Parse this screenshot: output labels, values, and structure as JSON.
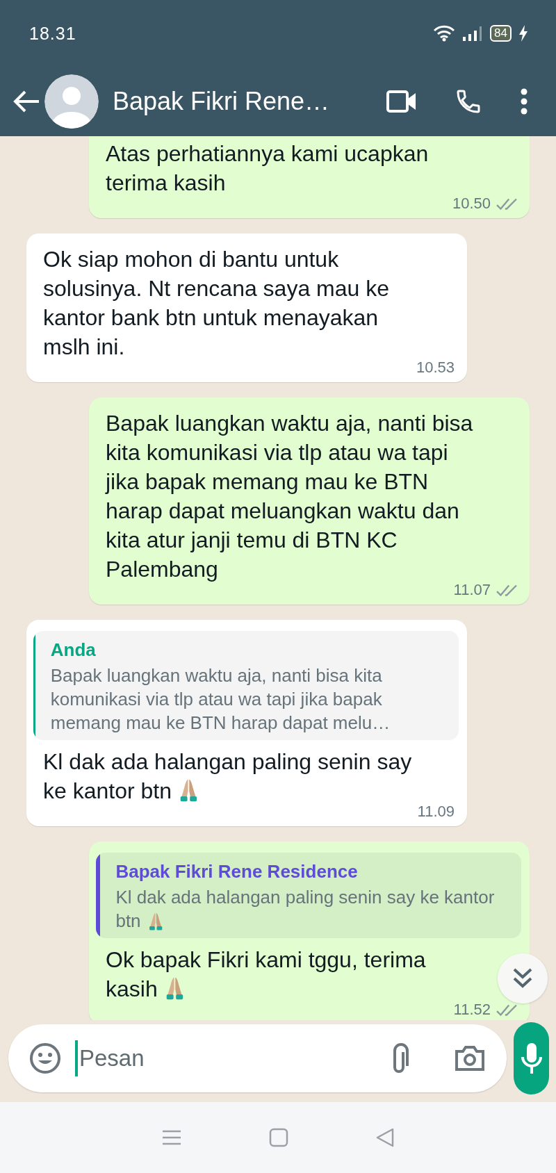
{
  "status_bar": {
    "time": "18.31",
    "battery": "84",
    "charging": true
  },
  "header": {
    "title": "Bapak Fikri Rene…"
  },
  "messages": [
    {
      "kind": "out",
      "text": "Atas perhatiannya kami ucapkan terima kasih",
      "time": "10.50",
      "read": false,
      "cut_top": true
    },
    {
      "kind": "in",
      "text": "Ok siap mohon di bantu untuk solusinya. Nt rencana saya mau ke kantor bank btn untuk menayakan mslh ini.",
      "time": "10.53"
    },
    {
      "kind": "out",
      "text": "Bapak luangkan waktu aja, nanti bisa kita komunikasi via tlp atau wa tapi jika bapak memang mau ke BTN harap dapat meluangkan waktu dan kita atur janji temu di BTN KC Palembang",
      "time": "11.07",
      "read": false
    },
    {
      "kind": "in",
      "quote": {
        "author": "Anda",
        "color": "#06a884",
        "text": "Bapak luangkan waktu aja, nanti bisa kita komunikasi via tlp atau wa tapi jika bapak memang mau ke BTN harap dapat melu…"
      },
      "text": "Kl dak ada halangan paling senin say ke kantor btn",
      "hands_emoji": true,
      "time": "11.09"
    },
    {
      "kind": "out",
      "quote": {
        "author": "Bapak Fikri Rene Residence",
        "color": "#5e4bd8",
        "text": "Kl dak ada halangan paling senin say ke kantor btn",
        "hands_emoji": true
      },
      "text": "Ok bapak Fikri kami tggu, terima kasih",
      "hands_emoji": true,
      "time": "11.52",
      "read": false
    }
  ],
  "composer": {
    "placeholder": "Pesan"
  }
}
